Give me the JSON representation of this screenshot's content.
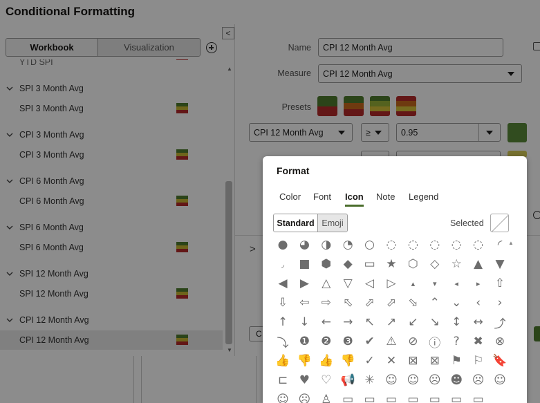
{
  "dialog": {
    "title": "Conditional Formatting",
    "segment": {
      "workbook": "Workbook",
      "visualization": "Visualization"
    },
    "collapse_glyph": "<"
  },
  "rule_groups": [
    {
      "group": "SPI 3 Month Avg",
      "rule": "SPI 3 Month Avg"
    },
    {
      "group": "CPI 3 Month Avg",
      "rule": "CPI 3 Month Avg"
    },
    {
      "group": "CPI 6 Month Avg",
      "rule": "CPI 6 Month Avg"
    },
    {
      "group": "SPI 6 Month Avg",
      "rule": "SPI 6 Month Avg"
    },
    {
      "group": "SPI 12 Month Avg",
      "rule": "SPI 12 Month Avg"
    },
    {
      "group": "CPI 12 Month Avg",
      "rule": "CPI 12 Month Avg"
    }
  ],
  "partial_top_item": "YTD SPI",
  "selected_rule": "CPI 12 Month Avg",
  "flag_colors": [
    "#4f7c2e",
    "#c9b732",
    "#b52a2a"
  ],
  "form": {
    "name_label": "Name",
    "name_value": "CPI 12 Month Avg",
    "measure_label": "Measure",
    "measure_value": "CPI 12 Month Avg",
    "presets_label": "Presets",
    "condition_measure": "CPI 12 Month Avg",
    "condition_operator": "≥",
    "condition_value": "0.95",
    "condition_color": "#5a8a3a",
    "second_color": "#d9cf58",
    "expand_glyph": ">",
    "partial_button": "C"
  },
  "presets": [
    [
      "#4f7c2e",
      "#b52a2a"
    ],
    [
      "#4f7c2e",
      "#c96a1e",
      "#b52a2a"
    ],
    [
      "#4f7c2e",
      "#9ab23a",
      "#d8c43a",
      "#b52a2a"
    ],
    [
      "#b52a2a",
      "#c96a1e",
      "#d8c43a",
      "#b52a2a"
    ]
  ],
  "format_popup": {
    "title": "Format",
    "tabs": [
      "Color",
      "Font",
      "Icon",
      "Note",
      "Legend"
    ],
    "active_tab": "Icon",
    "icon_sets": {
      "standard": "Standard",
      "emoji": "Emoji"
    },
    "selected_label": "Selected",
    "icons": [
      [
        "circle-full",
        "●"
      ],
      [
        "circle-three-quarter",
        "◕"
      ],
      [
        "circle-half",
        "◑"
      ],
      [
        "circle-quarter",
        "◔"
      ],
      [
        "circle-empty",
        "○"
      ],
      [
        "ring-segment-1",
        "◌"
      ],
      [
        "ring-segment-2",
        "◌"
      ],
      [
        "ring-segment-3",
        "◌"
      ],
      [
        "ring-segment-4",
        "◌"
      ],
      [
        "ring-segment-5",
        "◌"
      ],
      [
        "ring-segment-6",
        "◜"
      ],
      [
        "ring-segment-7",
        "◞"
      ],
      [
        "square",
        "■"
      ],
      [
        "hexagon",
        "⬢"
      ],
      [
        "diamond",
        "◆"
      ],
      [
        "rectangle",
        "▭"
      ],
      [
        "star",
        "★"
      ],
      [
        "hexagon-outline",
        "⬡"
      ],
      [
        "diamond-outline",
        "◇"
      ],
      [
        "star-outline",
        "☆"
      ],
      [
        "triangle-up",
        "▲"
      ],
      [
        "triangle-down",
        "▼"
      ],
      [
        "triangle-left",
        "◀"
      ],
      [
        "triangle-right",
        "▶"
      ],
      [
        "triangle-up-outline",
        "△"
      ],
      [
        "triangle-down-outline",
        "▽"
      ],
      [
        "triangle-left-outline",
        "◁"
      ],
      [
        "triangle-right-outline",
        "▷"
      ],
      [
        "small-triangle-up",
        "▴"
      ],
      [
        "small-triangle-down",
        "▾"
      ],
      [
        "small-triangle-left",
        "◂"
      ],
      [
        "small-triangle-right",
        "▸"
      ],
      [
        "arrow-up-outline",
        "⇧"
      ],
      [
        "arrow-down-outline",
        "⇩"
      ],
      [
        "arrow-left-outline",
        "⇦"
      ],
      [
        "arrow-right-outline",
        "⇨"
      ],
      [
        "arrow-upleft-outline",
        "⬁"
      ],
      [
        "arrow-upright-outline",
        "⬀"
      ],
      [
        "arrow-upright-outline-2",
        "⬀"
      ],
      [
        "arrow-downright-outline",
        "⬂"
      ],
      [
        "chevron-up",
        "⌃"
      ],
      [
        "chevron-down",
        "⌄"
      ],
      [
        "chevron-left",
        "‹"
      ],
      [
        "chevron-right",
        "›"
      ],
      [
        "arrow-up",
        "↑"
      ],
      [
        "arrow-down",
        "↓"
      ],
      [
        "arrow-left",
        "←"
      ],
      [
        "arrow-right",
        "→"
      ],
      [
        "arrow-upleft",
        "↖"
      ],
      [
        "arrow-upright",
        "↗"
      ],
      [
        "arrow-downleft",
        "↙"
      ],
      [
        "arrow-downright",
        "↘"
      ],
      [
        "arrow-updown",
        "↕"
      ],
      [
        "arrow-leftright",
        "↔"
      ],
      [
        "trend-up",
        "⤴"
      ],
      [
        "trend-down",
        "⤵"
      ],
      [
        "number-1",
        "❶"
      ],
      [
        "number-2",
        "❷"
      ],
      [
        "number-3",
        "❸"
      ],
      [
        "check-circle",
        "✔"
      ],
      [
        "warning",
        "⚠"
      ],
      [
        "no-entry",
        "⊘"
      ],
      [
        "info",
        "ⓘ"
      ],
      [
        "question",
        "?"
      ],
      [
        "x-circle",
        "✖"
      ],
      [
        "x-circle-outline",
        "⊗"
      ],
      [
        "thumbs-up",
        "👍"
      ],
      [
        "thumbs-down",
        "👎"
      ],
      [
        "thumbs-up-outline",
        "👍"
      ],
      [
        "thumbs-down-outline",
        "👎"
      ],
      [
        "check",
        "✓"
      ],
      [
        "cross",
        "✕"
      ],
      [
        "x-box",
        "⊠"
      ],
      [
        "x-box-outline",
        "⊠"
      ],
      [
        "flag",
        "⚑"
      ],
      [
        "flag-outline",
        "⚐"
      ],
      [
        "bookmark",
        "🔖"
      ],
      [
        "bookmark-outline",
        "⊏"
      ],
      [
        "heart",
        "♥"
      ],
      [
        "heart-outline",
        "♡"
      ],
      [
        "megaphone",
        "📢"
      ],
      [
        "asterisk",
        "✳"
      ],
      [
        "face-smile",
        "☺"
      ],
      [
        "face-neutral",
        "☺"
      ],
      [
        "face-sad",
        "☹"
      ],
      [
        "face-grin",
        "☻"
      ],
      [
        "face-frown",
        "☹"
      ],
      [
        "face-smile-outline",
        "☺"
      ],
      [
        "face-smile-2",
        "☺"
      ],
      [
        "face-sad-2",
        "☹"
      ],
      [
        "person",
        "♙"
      ],
      [
        "battery-1",
        "▭"
      ],
      [
        "battery-2",
        "▭"
      ],
      [
        "battery-3",
        "▭"
      ],
      [
        "battery-4",
        "▭"
      ],
      [
        "battery-5",
        "▭"
      ],
      [
        "battery-6",
        "▭"
      ],
      [
        "battery-7",
        "▭"
      ]
    ]
  }
}
